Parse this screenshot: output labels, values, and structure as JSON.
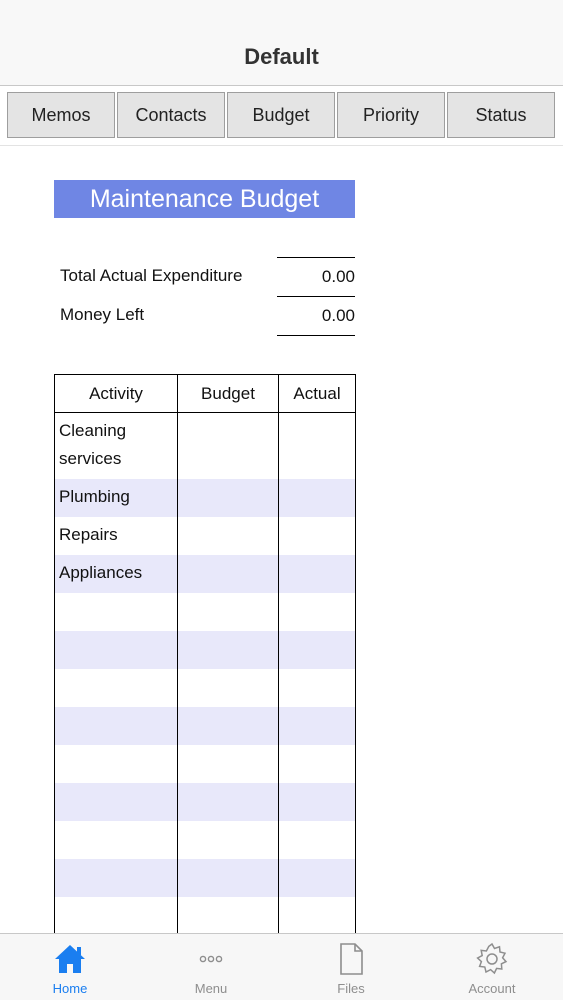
{
  "nav": {
    "title": "Default"
  },
  "tabs": [
    {
      "label": "Memos"
    },
    {
      "label": "Contacts"
    },
    {
      "label": "Budget"
    },
    {
      "label": "Priority"
    },
    {
      "label": "Status"
    }
  ],
  "budget": {
    "title": "Maintenance Budget",
    "total_label": "Total Actual Expenditure",
    "total_value": "0.00",
    "money_left_label": "Money Left",
    "money_left_value": "0.00"
  },
  "table": {
    "headers": [
      "Activity",
      "Budget",
      "Actual"
    ],
    "rows": [
      {
        "activity": "Cleaning services",
        "budget": "",
        "actual": ""
      },
      {
        "activity": "Plumbing",
        "budget": "",
        "actual": ""
      },
      {
        "activity": "Repairs",
        "budget": "",
        "actual": ""
      },
      {
        "activity": "Appliances",
        "budget": "",
        "actual": ""
      },
      {
        "activity": "",
        "budget": "",
        "actual": ""
      },
      {
        "activity": "",
        "budget": "",
        "actual": ""
      },
      {
        "activity": "",
        "budget": "",
        "actual": ""
      },
      {
        "activity": "",
        "budget": "",
        "actual": ""
      },
      {
        "activity": "",
        "budget": "",
        "actual": ""
      },
      {
        "activity": "",
        "budget": "",
        "actual": ""
      },
      {
        "activity": "",
        "budget": "",
        "actual": ""
      },
      {
        "activity": "",
        "budget": "",
        "actual": ""
      },
      {
        "activity": "",
        "budget": "",
        "actual": ""
      },
      {
        "activity": "",
        "budget": "",
        "actual": ""
      }
    ]
  },
  "tabbar": {
    "items": [
      {
        "label": "Home",
        "icon": "home-icon",
        "active": true
      },
      {
        "label": "Menu",
        "icon": "more-icon",
        "active": false
      },
      {
        "label": "Files",
        "icon": "file-icon",
        "active": false
      },
      {
        "label": "Account",
        "icon": "gear-icon",
        "active": false
      }
    ],
    "active_color": "#1a7ef0",
    "inactive_color": "#8e8e8e"
  },
  "colors": {
    "title_bar": "#6f86e4",
    "alt_row": "#e8e8fa"
  }
}
